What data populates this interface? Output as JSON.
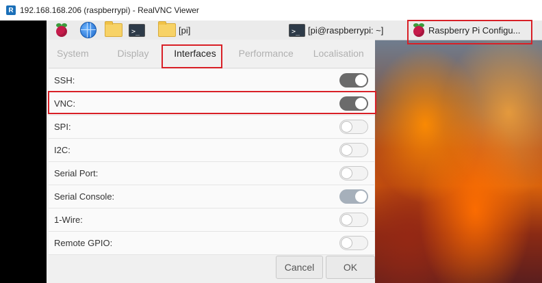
{
  "window": {
    "title": "192.168.168.206 (raspberrypi) - RealVNC Viewer",
    "logo_text": "R"
  },
  "taskbar": {
    "folder_label": "[pi]",
    "terminal_label": "[pi@raspberrypi: ~]",
    "terminal_glyph": ">_",
    "config_label": "Raspberry Pi Configu...",
    "icons": [
      "raspberry-menu-icon",
      "globe-icon",
      "file-manager-icon",
      "terminal-icon",
      "folder-icon",
      "terminal-icon",
      "raspberry-icon"
    ]
  },
  "dialog": {
    "tabs": [
      {
        "label": "System",
        "active": false
      },
      {
        "label": "Display",
        "active": false
      },
      {
        "label": "Interfaces",
        "active": true
      },
      {
        "label": "Performance",
        "active": false
      },
      {
        "label": "Localisation",
        "active": false
      }
    ],
    "rows": [
      {
        "label": "SSH:",
        "state": "on"
      },
      {
        "label": "VNC:",
        "state": "on"
      },
      {
        "label": "SPI:",
        "state": "off"
      },
      {
        "label": "I2C:",
        "state": "off"
      },
      {
        "label": "Serial Port:",
        "state": "off"
      },
      {
        "label": "Serial Console:",
        "state": "on-disabled"
      },
      {
        "label": "1-Wire:",
        "state": "off"
      },
      {
        "label": "Remote GPIO:",
        "state": "off"
      }
    ],
    "cancel_label": "Cancel",
    "ok_label": "OK"
  },
  "colors": {
    "highlight": "#d81f26",
    "toggle_on": "#6b6b6b",
    "toggle_on_disabled": "#a6b0bb"
  }
}
